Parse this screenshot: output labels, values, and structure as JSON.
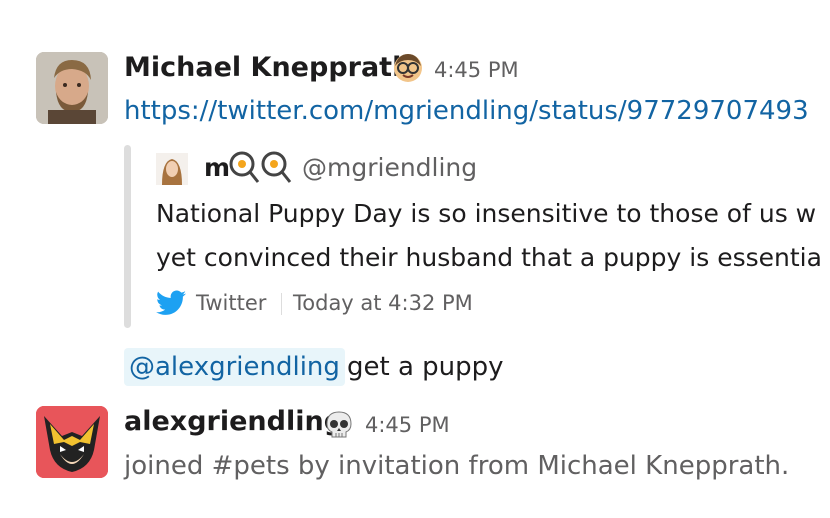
{
  "messages": [
    {
      "author": "Michael Knepprath",
      "status_icon": "nerd-face-emoji",
      "time": "4:45 PM",
      "link": "https://twitter.com/mgriendling/status/97729707493",
      "tweet": {
        "name": "m",
        "name_icons": [
          "fried-egg-emoji",
          "fried-egg-emoji"
        ],
        "handle": "@mgriendling",
        "line1": "National Puppy Day is so insensitive to those of us w",
        "line2": "yet convinced their husband that a puppy is essentia",
        "source": "Twitter",
        "timestamp": "Today at 4:32 PM",
        "source_icon": "twitter-bird-icon"
      },
      "reply_mention": "@alexgriendling",
      "reply_text": "get a puppy"
    },
    {
      "author": "alexgriendling",
      "status_icon": "skull-emoji",
      "time": "4:45 PM",
      "system_text": "joined #pets by invitation from Michael Knepprath."
    }
  ],
  "colors": {
    "link": "#1264a3",
    "mention_bg": "#e8f5fa",
    "secondary_text": "#616061",
    "twitter_blue": "#1da1f2",
    "avatar2_bg": "#e8555a"
  }
}
